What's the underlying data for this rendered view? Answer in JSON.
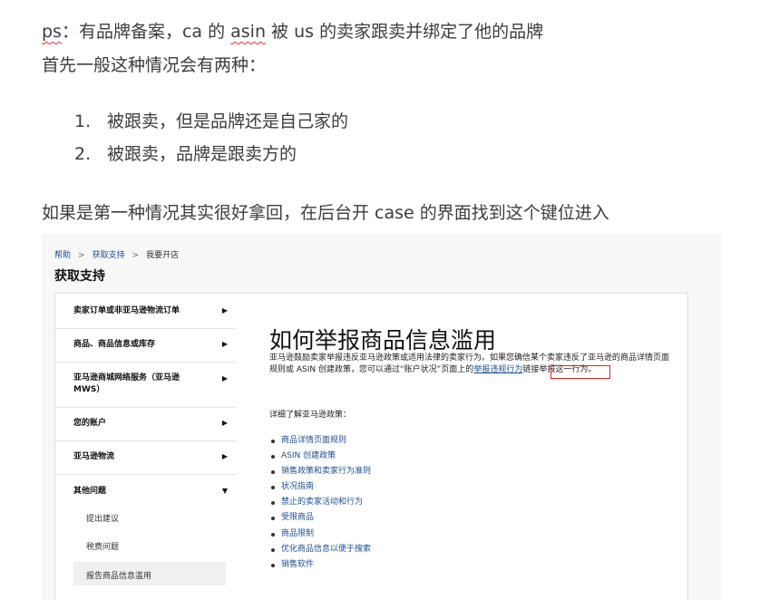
{
  "article": {
    "ps_prefix": "ps",
    "ps_text": "：有品牌备案，ca 的 ",
    "ps_asin": "asin",
    "ps_text2": " 被 us 的卖家跟卖并绑定了他的品牌",
    "line2": "首先一般这种情况会有两种：",
    "list": [
      {
        "num": "1.",
        "text": "被跟卖，但是品牌还是自己家的"
      },
      {
        "num": "2.",
        "text": "被跟卖，品牌是跟卖方的"
      }
    ],
    "line3": "如果是第一种情况其实很好拿回，在后台开 case 的界面找到这个键位进入"
  },
  "screenshot": {
    "breadcrumb": {
      "items": [
        "帮助",
        "获取支持",
        "我要开店"
      ],
      "separator": ">"
    },
    "title": "获取支持",
    "nav": {
      "items": [
        {
          "label": "卖家订单或非亚马逊物流订单",
          "arrow": "▶"
        },
        {
          "label": "商品、商品信息或库存",
          "arrow": "▶"
        },
        {
          "label": "亚马逊商城网络服务（亚马逊 MWS）",
          "arrow": "▶"
        },
        {
          "label": "您的账户",
          "arrow": "▶"
        },
        {
          "label": "亚马逊物流",
          "arrow": "▶"
        },
        {
          "label": "其他问题",
          "arrow": "▼"
        }
      ],
      "sub_items": [
        "提出建议",
        "税费问题",
        "报告商品信息滥用"
      ]
    },
    "content": {
      "heading": "如何举报商品信息滥用",
      "para_1": "亚马逊鼓励卖家举报违反亚马逊政策或适用法律的卖家行为。如果您确信某个卖家违反了亚马逊的商品详情页面规则或 ASIN 创建政策，您可以通过“账户状况”页面上的",
      "report_link": "举报违规行为",
      "para_2": "链接举报这一行为。",
      "learn_more": "详细了解亚马逊政策：",
      "policies": [
        "商品详情页面规则",
        "ASIN 创建政策",
        "销售政策和卖家行为准则",
        "状况指南",
        "禁止的卖家活动和行为",
        "受限商品",
        "商品限制",
        "优化商品信息以便于搜索",
        "销售软件"
      ]
    }
  },
  "colors": {
    "link": "#1d4e91",
    "highlight_box": "#e02020",
    "spell_underline": "#e0303a"
  }
}
